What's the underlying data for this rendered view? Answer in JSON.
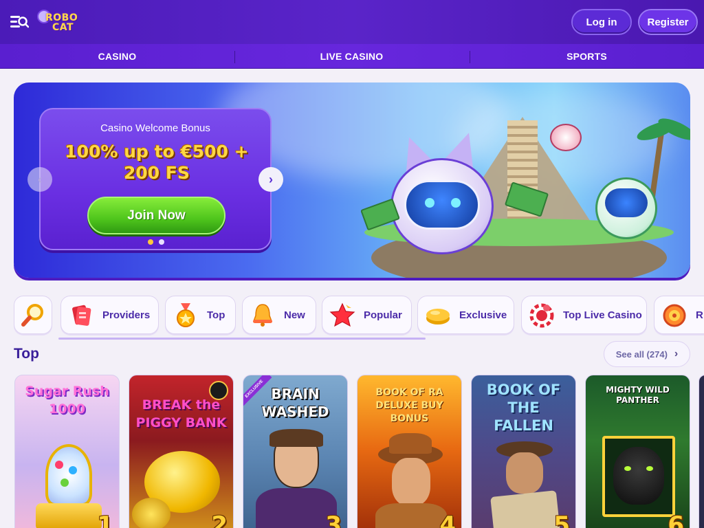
{
  "header": {
    "logo_line1": "ROBO",
    "logo_line2": "CAT",
    "login_label": "Log in",
    "register_label": "Register"
  },
  "nav": {
    "items": [
      {
        "label": "CASINO"
      },
      {
        "label": "LIVE CASINO"
      },
      {
        "label": "SPORTS"
      }
    ]
  },
  "hero": {
    "subtitle": "Casino Welcome Bonus",
    "title_line1": "100% up to €500 +",
    "title_line2": "200 FS",
    "cta_label": "Join Now",
    "slide_count": 2,
    "active_slide": 1
  },
  "categories": [
    {
      "label": "",
      "icon": "search-icon"
    },
    {
      "label": "Providers",
      "icon": "providers-icon"
    },
    {
      "label": "Top",
      "icon": "medal-icon"
    },
    {
      "label": "New",
      "icon": "bell-icon"
    },
    {
      "label": "Popular",
      "icon": "star-icon"
    },
    {
      "label": "Exclusive",
      "icon": "gold-icon"
    },
    {
      "label": "Top Live Casino",
      "icon": "roulette-chip-icon"
    },
    {
      "label": "R",
      "icon": "roulette-icon"
    }
  ],
  "section": {
    "title": "Top",
    "see_all_label": "See all (274)"
  },
  "games": [
    {
      "title": "Sugar Rush 1000",
      "rank": "1"
    },
    {
      "title": "BREAK the PIGGY BANK",
      "rank": "2"
    },
    {
      "title": "BRAIN WASHED",
      "rank": "3",
      "badge": "EXCLUSIVE"
    },
    {
      "title": "BOOK OF RA DELUXE BUY BONUS",
      "rank": "4"
    },
    {
      "title": "BOOK OF THE FALLEN",
      "rank": "5"
    },
    {
      "title": "MIGHTY WILD PANTHER",
      "rank": "6"
    }
  ],
  "colors": {
    "brand_purple": "#5a24c9",
    "accent_yellow": "#ffd743",
    "cta_green": "#4fc51c"
  }
}
